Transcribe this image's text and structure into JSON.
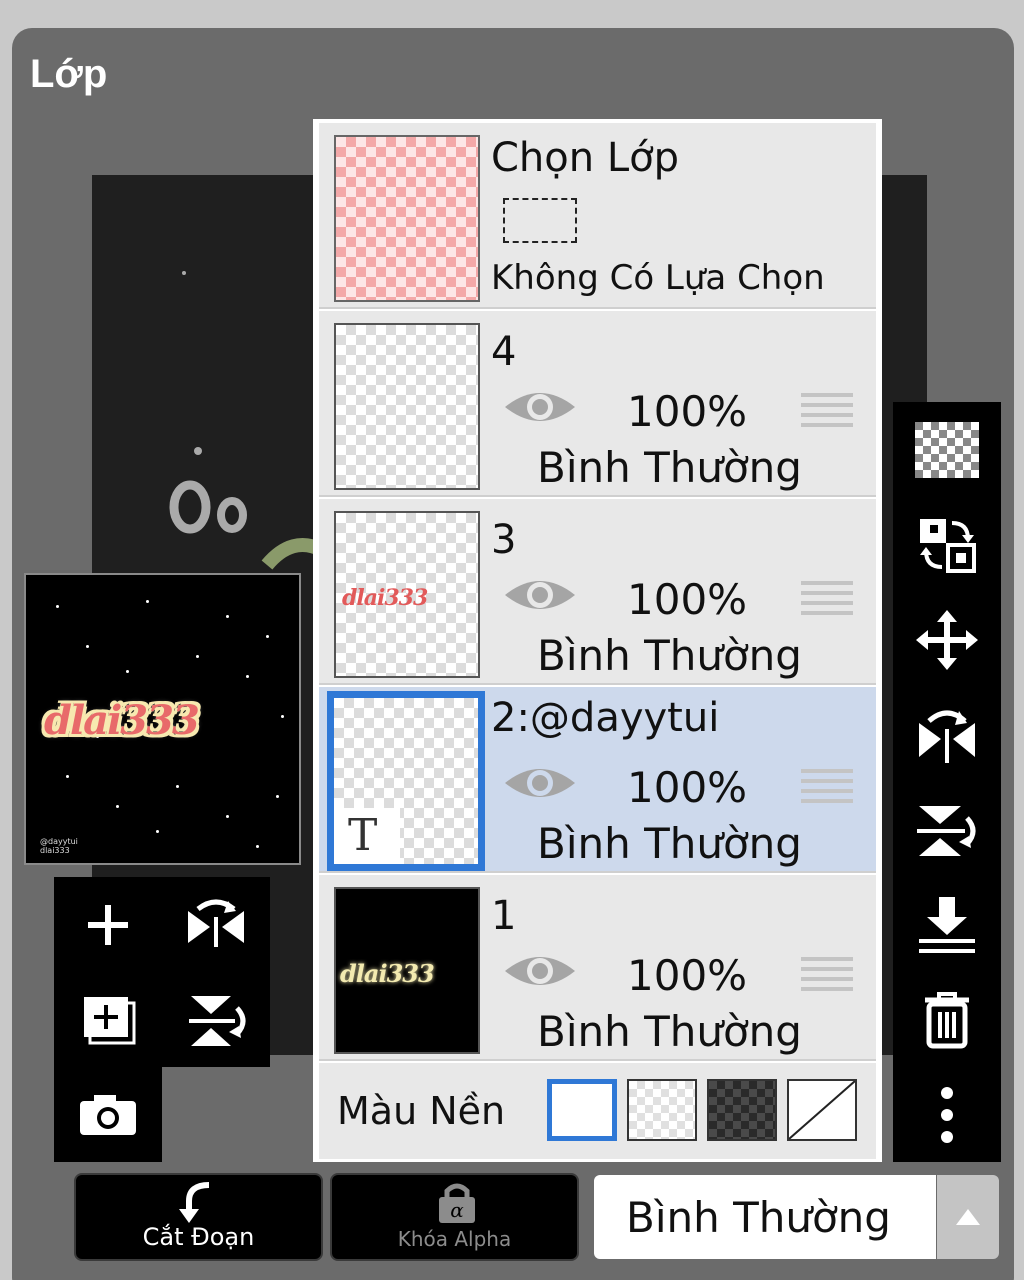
{
  "panel": {
    "title": "Lớp"
  },
  "preview": {
    "art_text": "dlai333",
    "small_text": "@dayytui\ndlai333"
  },
  "layers": [
    {
      "name": "Chọn Lớp",
      "subtitle": "Không Có Lựa Chọn",
      "type": "selection"
    },
    {
      "name": "4",
      "opacity": "100%",
      "blend": "Bình Thường",
      "visible": true,
      "selected": false
    },
    {
      "name": "3",
      "opacity": "100%",
      "blend": "Bình Thường",
      "visible": true,
      "selected": false,
      "thumb_text": "dlai333"
    },
    {
      "name": "2:@dayytui",
      "opacity": "100%",
      "blend": "Bình Thường",
      "visible": true,
      "selected": true,
      "thumb_badge": "T"
    },
    {
      "name": "1",
      "opacity": "100%",
      "blend": "Bình Thường",
      "visible": true,
      "selected": false,
      "thumb_text": "dlai333"
    }
  ],
  "background": {
    "label": "Màu Nền",
    "selected": "white"
  },
  "bottom": {
    "clip_label": "Cắt Đoạn",
    "alpha_lock_label": "Khóa Alpha",
    "blend_mode": "Bình Thường"
  },
  "colors": {
    "selected_blue": "#2f78d6",
    "selected_row": "#cdd9ec",
    "panel": "#6b6b6b",
    "toolbar": "#000000"
  }
}
